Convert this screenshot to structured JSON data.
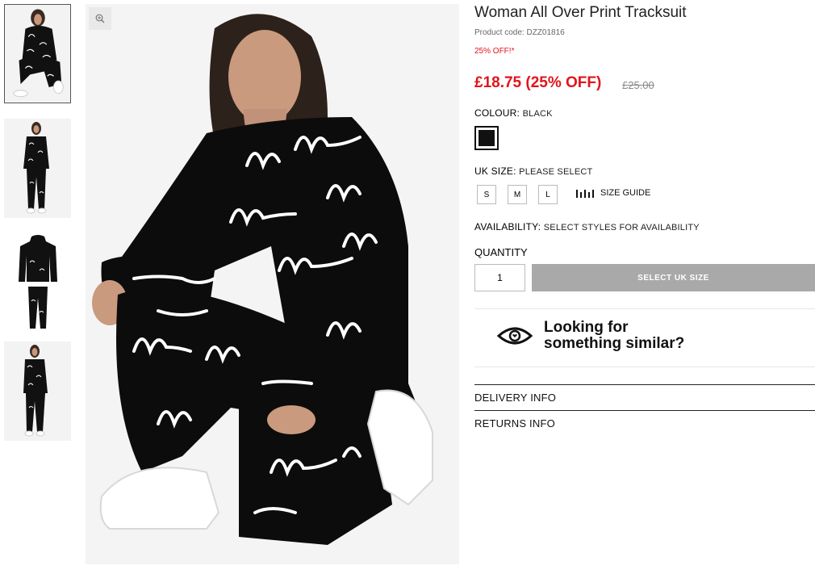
{
  "gallery": {
    "thumbnails": [
      {
        "alt": "tracksuit-front-crouching"
      },
      {
        "alt": "tracksuit-standing"
      },
      {
        "alt": "tracksuit-flat-lay"
      },
      {
        "alt": "tracksuit-standing-side"
      }
    ],
    "zoom_icon": "magnifier-plus-icon"
  },
  "product": {
    "title": "Woman All Over Print Tracksuit",
    "code": "Product code: DZZ01816",
    "promo": "25% OFF!*",
    "price_now": "£18.75 (25% OFF)",
    "price_was": "£25.00",
    "colors": {
      "sale": "#e1141b",
      "button_disabled": "#a9a9a9"
    }
  },
  "colour": {
    "label": "COLOUR:",
    "value": "BLACK",
    "swatch": "#111111"
  },
  "size": {
    "label": "UK SIZE:",
    "value": "PLEASE SELECT",
    "options": [
      "S",
      "M",
      "L"
    ],
    "guide_label": "SIZE GUIDE",
    "guide_icon": "ruler-icon"
  },
  "availability": {
    "label": "AVAILABILITY:",
    "value": "SELECT STYLES FOR AVAILABILITY"
  },
  "quantity": {
    "label": "QUANTITY",
    "value": "1"
  },
  "cta": {
    "label": "SELECT UK SIZE"
  },
  "similar": {
    "line1": "Looking for",
    "line2": "something similar?",
    "icon": "eye-icon"
  },
  "accordions": [
    "DELIVERY INFO",
    "RETURNS INFO"
  ]
}
